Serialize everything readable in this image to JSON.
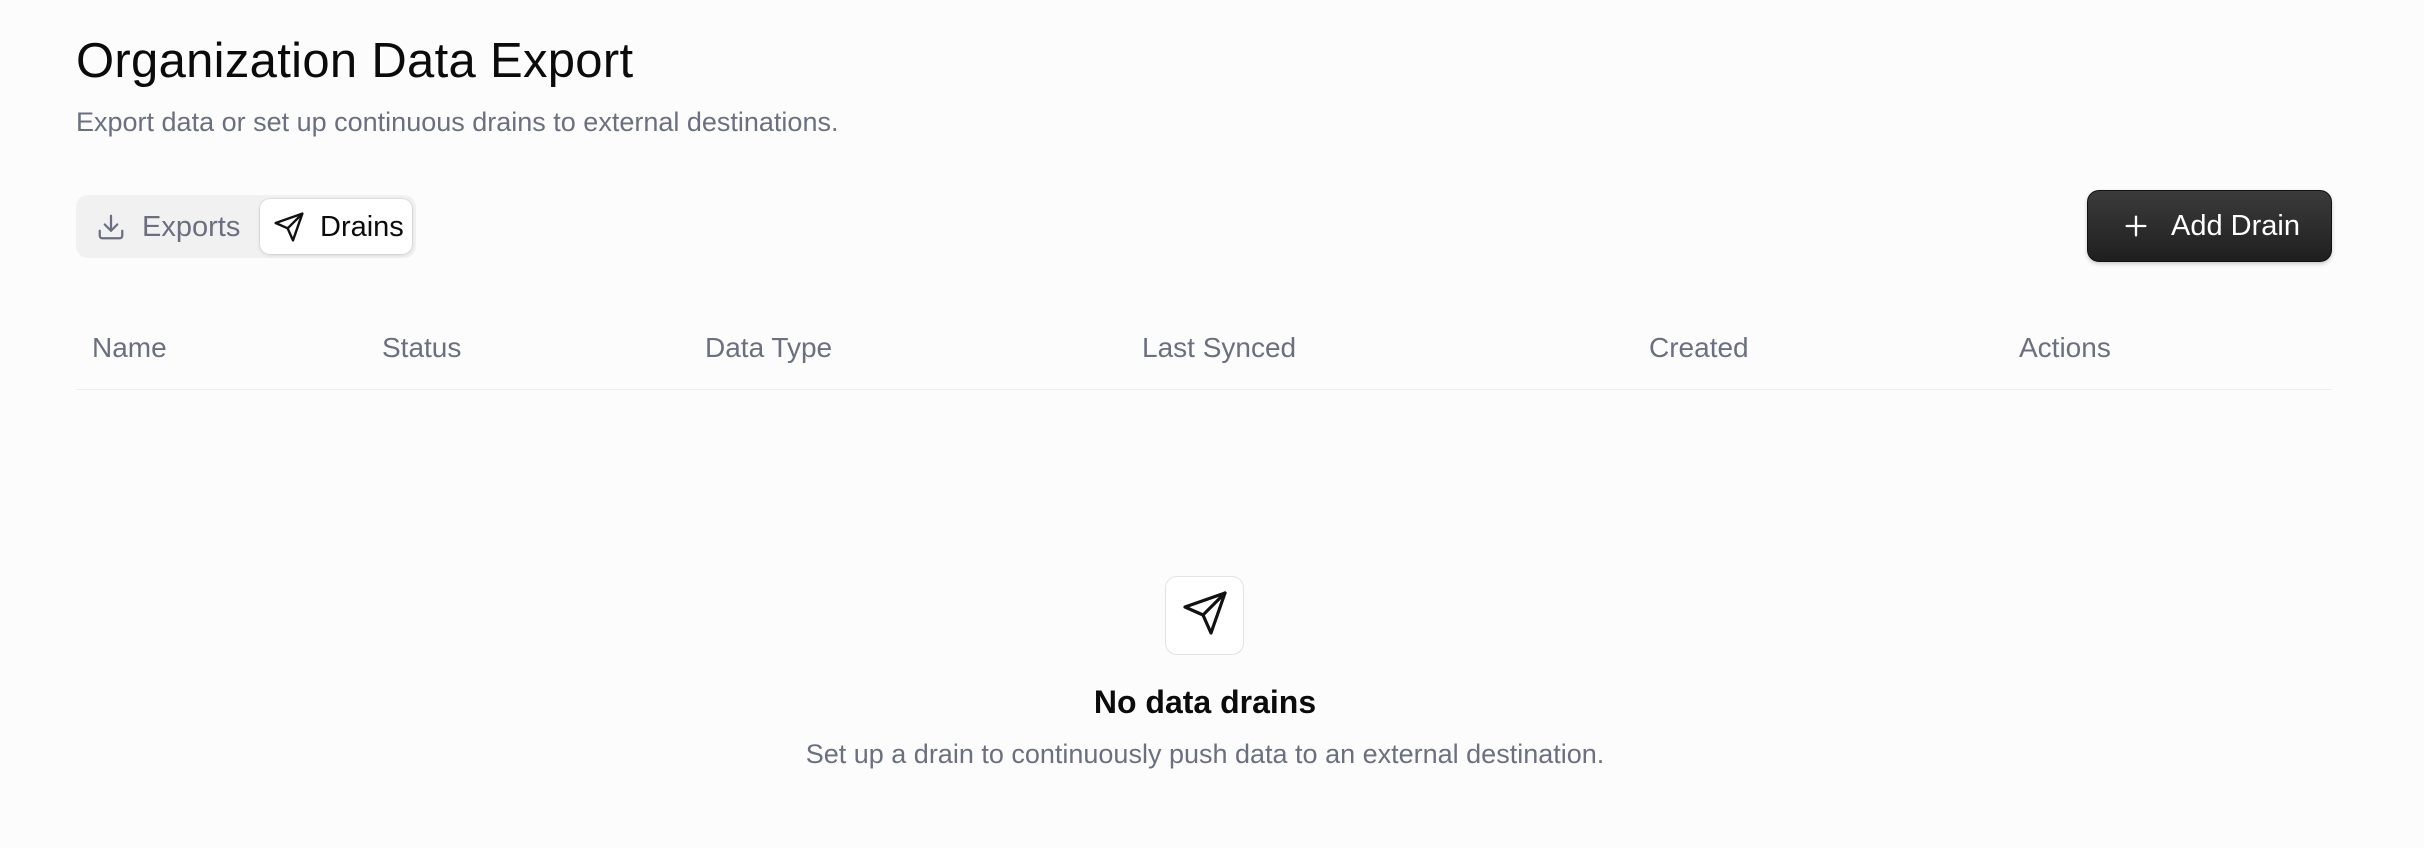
{
  "header": {
    "title": "Organization Data Export",
    "subtitle": "Export data or set up continuous drains to external destinations."
  },
  "tabs": [
    {
      "label": "Exports",
      "icon": "download-icon",
      "active": false
    },
    {
      "label": "Drains",
      "icon": "send-icon",
      "active": true
    }
  ],
  "toolbar": {
    "add_label": "Add Drain",
    "add_icon": "plus-icon"
  },
  "table": {
    "columns": [
      "Name",
      "Status",
      "Data Type",
      "Last Synced",
      "Created",
      "Actions"
    ],
    "rows": []
  },
  "empty_state": {
    "icon": "send-icon",
    "title": "No data drains",
    "description": "Set up a drain to continuously push data to an external destination."
  },
  "colors": {
    "background": "#fcfcfc",
    "muted_text": "#6b7080",
    "primary_button": "#2b2b2b"
  }
}
